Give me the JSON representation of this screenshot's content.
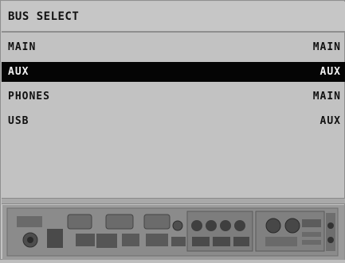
{
  "header": {
    "title": "BUS SELECT"
  },
  "rows": [
    {
      "label": "MAIN",
      "value": "MAIN"
    },
    {
      "label": "AUX",
      "value": "AUX"
    },
    {
      "label": "PHONES",
      "value": "MAIN"
    },
    {
      "label": "USB",
      "value": "AUX"
    }
  ],
  "selected_row": 1,
  "colors": {
    "background": "#c2c2c2",
    "selection": "#050505",
    "selection_text": "#f2f2f2"
  },
  "rear_panel": {
    "icon": "rear-panel-image"
  }
}
